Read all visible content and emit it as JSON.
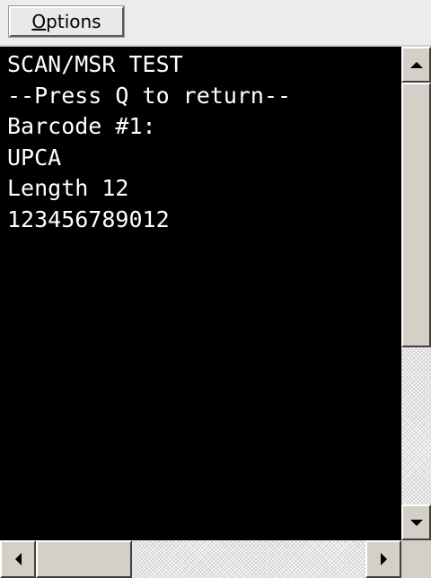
{
  "menubar": {
    "options_label_accel": "O",
    "options_label_rest": "ptions"
  },
  "terminal": {
    "lines": [
      "SCAN/MSR TEST",
      "--Press Q to return--",
      "Barcode #1:",
      "UPCA",
      "Length 12",
      "123456789012"
    ],
    "background": "#000000",
    "foreground": "#ffffff"
  },
  "icons": {
    "scroll_up": "triangle-up-icon",
    "scroll_down": "triangle-down-icon",
    "scroll_left": "triangle-left-icon",
    "scroll_right": "triangle-right-icon"
  }
}
